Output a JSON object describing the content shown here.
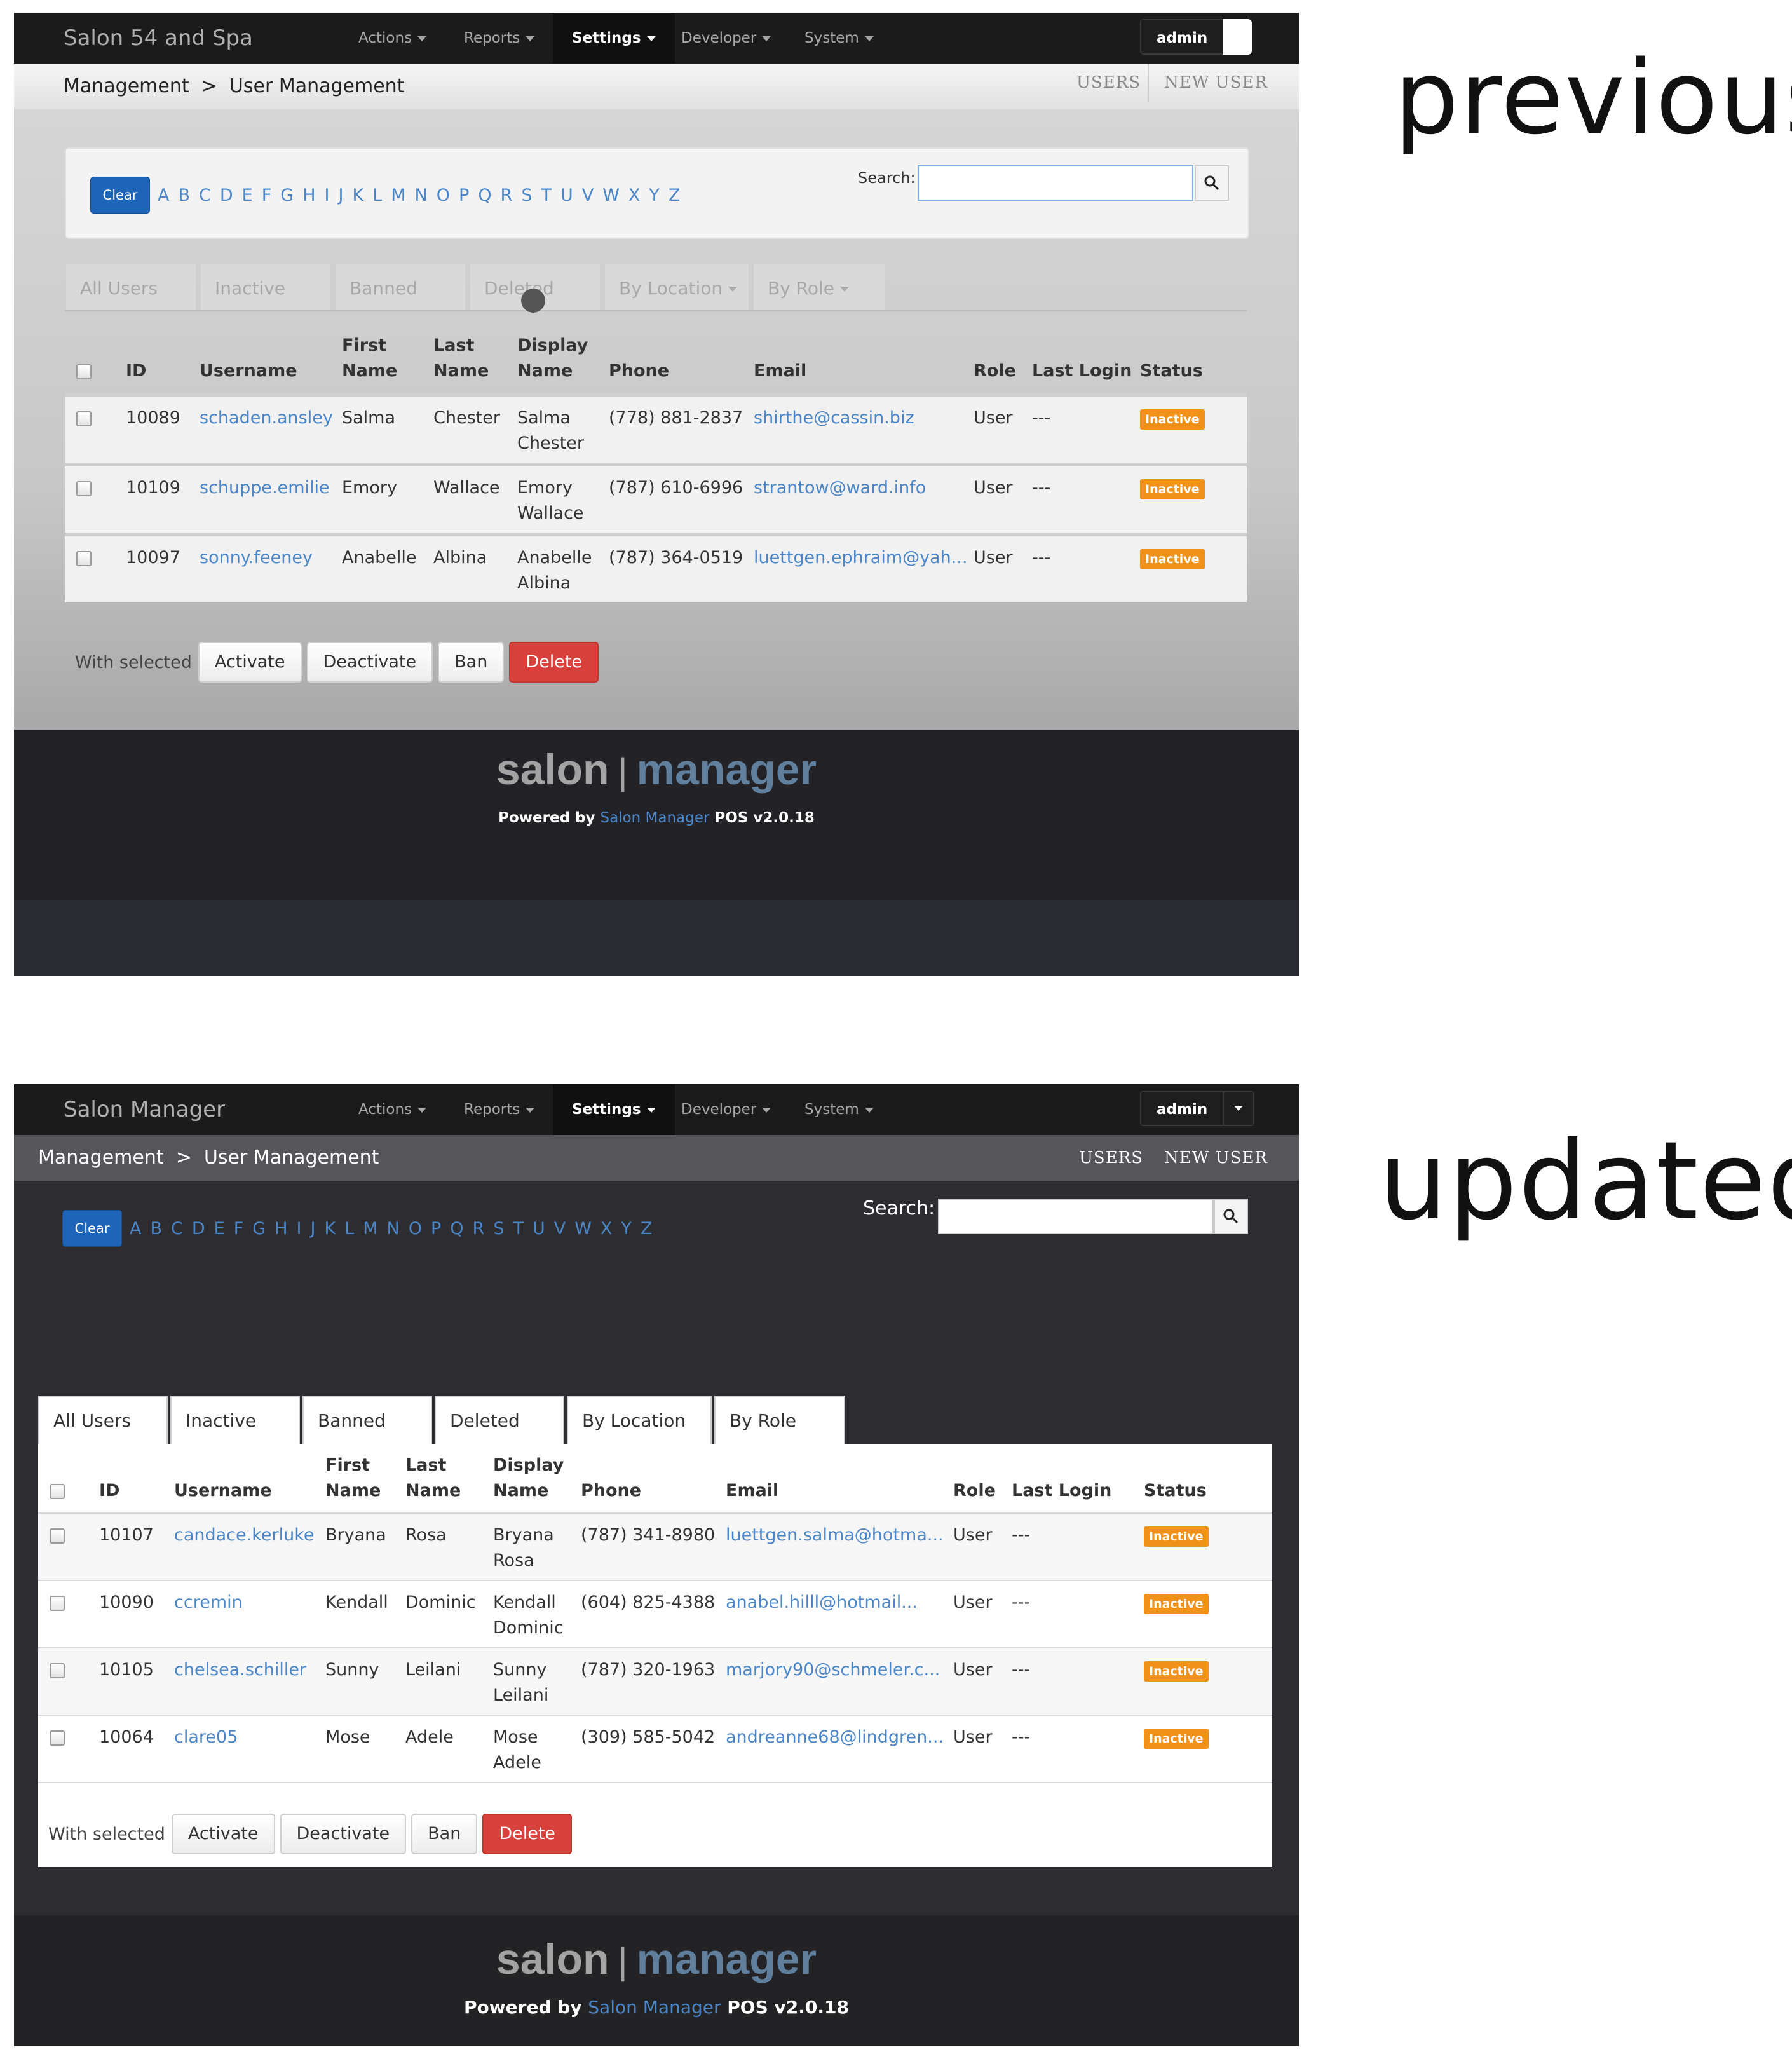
{
  "labels": {
    "previous": "previous",
    "updated": "updated"
  },
  "previous": {
    "brand": "Salon 54 and Spa",
    "nav": [
      "Actions",
      "Reports",
      "Settings",
      "Developer",
      "System"
    ],
    "admin_label": "admin",
    "breadcrumb": "Management  >  User Management",
    "sublinks": {
      "users": "USERS",
      "new_user": "NEW USER"
    },
    "clear_label": "Clear",
    "letters": [
      "A",
      "B",
      "C",
      "D",
      "E",
      "F",
      "G",
      "H",
      "I",
      "J",
      "K",
      "L",
      "M",
      "N",
      "O",
      "P",
      "Q",
      "R",
      "S",
      "T",
      "U",
      "V",
      "W",
      "X",
      "Y",
      "Z"
    ],
    "search_label": "Search:",
    "tabs": [
      "All Users",
      "Inactive",
      "Banned",
      "Deleted",
      "By Location",
      "By Role"
    ],
    "columns": {
      "id": "ID",
      "username": "Username",
      "first": "First Name",
      "last": "Last Name",
      "display": "Display Name",
      "phone": "Phone",
      "email": "Email",
      "role": "Role",
      "last_login": "Last Login",
      "status": "Status"
    },
    "rows": [
      {
        "id": "10089",
        "username": "schaden.ansley",
        "first": "Salma",
        "last": "Chester",
        "display": "Salma Chester",
        "phone": "(778) 881-2837",
        "email": "shirthe@cassin.biz",
        "role": "User",
        "last_login": "---",
        "status": "Inactive"
      },
      {
        "id": "10109",
        "username": "schuppe.emilie",
        "first": "Emory",
        "last": "Wallace",
        "display": "Emory Wallace",
        "phone": "(787) 610-6996",
        "email": "strantow@ward.info",
        "role": "User",
        "last_login": "---",
        "status": "Inactive"
      },
      {
        "id": "10097",
        "username": "sonny.feeney",
        "first": "Anabelle",
        "last": "Albina",
        "display": "Anabelle Albina",
        "phone": "(787) 364-0519",
        "email": "luettgen.ephraim@yah...",
        "role": "User",
        "last_login": "---",
        "status": "Inactive"
      }
    ],
    "with_selected": "With selected",
    "buttons": {
      "activate": "Activate",
      "deactivate": "Deactivate",
      "ban": "Ban",
      "delete": "Delete"
    },
    "footer": {
      "logo_left": "salon",
      "logo_sep": "|",
      "logo_right": "manager",
      "powered_prefix": "Powered by",
      "powered_link": "Salon Manager",
      "powered_suffix": "POS v2.0.18"
    }
  },
  "updated": {
    "brand": "Salon Manager",
    "nav": [
      "Actions",
      "Reports",
      "Settings",
      "Developer",
      "System"
    ],
    "admin_label": "admin",
    "breadcrumb": "Management  >  User Management",
    "sublinks": {
      "users": "USERS",
      "new_user": "NEW USER"
    },
    "clear_label": "Clear",
    "letters": [
      "A",
      "B",
      "C",
      "D",
      "E",
      "F",
      "G",
      "H",
      "I",
      "J",
      "K",
      "L",
      "M",
      "N",
      "O",
      "P",
      "Q",
      "R",
      "S",
      "T",
      "U",
      "V",
      "W",
      "X",
      "Y",
      "Z"
    ],
    "search_label": "Search:",
    "tabs": [
      "All Users",
      "Inactive",
      "Banned",
      "Deleted",
      "By Location",
      "By Role"
    ],
    "columns": {
      "id": "ID",
      "username": "Username",
      "first": "First Name",
      "last": "Last Name",
      "display": "Display Name",
      "phone": "Phone",
      "email": "Email",
      "role": "Role",
      "last_login": "Last Login",
      "status": "Status"
    },
    "rows": [
      {
        "id": "10107",
        "username": "candace.kerluke",
        "first": "Bryana",
        "last": "Rosa",
        "display": "Bryana Rosa",
        "phone": "(787) 341-8980",
        "email": "luettgen.salma@hotma...",
        "role": "User",
        "last_login": "---",
        "status": "Inactive"
      },
      {
        "id": "10090",
        "username": "ccremin",
        "first": "Kendall",
        "last": "Dominic",
        "display": "Kendall Dominic",
        "phone": "(604) 825-4388",
        "email": "anabel.hilll@hotmail...",
        "role": "User",
        "last_login": "---",
        "status": "Inactive"
      },
      {
        "id": "10105",
        "username": "chelsea.schiller",
        "first": "Sunny",
        "last": "Leilani",
        "display": "Sunny Leilani",
        "phone": "(787) 320-1963",
        "email": "marjory90@schmeler.c...",
        "role": "User",
        "last_login": "---",
        "status": "Inactive"
      },
      {
        "id": "10064",
        "username": "clare05",
        "first": "Mose",
        "last": "Adele",
        "display": "Mose Adele",
        "phone": "(309) 585-5042",
        "email": "andreanne68@lindgren...",
        "role": "User",
        "last_login": "---",
        "status": "Inactive"
      }
    ],
    "with_selected": "With selected",
    "buttons": {
      "activate": "Activate",
      "deactivate": "Deactivate",
      "ban": "Ban",
      "delete": "Delete"
    },
    "footer": {
      "logo_left": "salon",
      "logo_sep": "|",
      "logo_right": "manager",
      "powered_prefix": "Powered by",
      "powered_link": "Salon Manager",
      "powered_suffix": "POS v2.0.18"
    }
  },
  "colors": {
    "accent_blue": "#4b87c8",
    "clear_button": "#1e64b8",
    "badge_orange": "#f0921a",
    "delete_red": "#d9413c"
  }
}
